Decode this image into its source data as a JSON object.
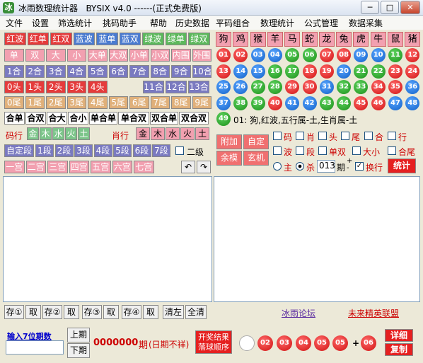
{
  "window": {
    "title": "冰雨数理统计器   BYSIX v4.0 ------(正式免费版)",
    "minimize": "─",
    "maximize": "□",
    "close": "✕"
  },
  "menu": [
    "文件",
    "设置",
    "筛选统计",
    "挑码助手",
    "帮助",
    "历史数据",
    "平码组合",
    "数理统计",
    "公式管理",
    "数据采集"
  ],
  "row1": [
    "红波",
    "红单",
    "红双",
    "蓝波",
    "蓝单",
    "蓝双",
    "绿波",
    "绿单",
    "绿双"
  ],
  "row2": [
    "单",
    "双",
    "大",
    "小",
    "大单",
    "大双",
    "小单",
    "小双",
    "内围",
    "外围"
  ],
  "row3": [
    "1合",
    "2合",
    "3合",
    "4合",
    "5合",
    "6合",
    "7合",
    "8合",
    "9合",
    "10合"
  ],
  "row4a": [
    "0头",
    "1头",
    "2头",
    "3头",
    "4头"
  ],
  "row4b": [
    "11合",
    "12合",
    "13合"
  ],
  "row5": [
    "0尾",
    "1尾",
    "2尾",
    "3尾",
    "4尾",
    "5尾",
    "6尾",
    "7尾",
    "8尾",
    "9尾"
  ],
  "row6": [
    "合单",
    "合双",
    "合大",
    "合小",
    "单合单",
    "单合双",
    "双合单",
    "双合双"
  ],
  "row7": {
    "label1": "码行",
    "elems1": [
      "金",
      "木",
      "水",
      "火",
      "土"
    ],
    "label2": "肖行",
    "elems2": [
      "金",
      "木",
      "水",
      "火",
      "土"
    ]
  },
  "row8": {
    "items": [
      "自定段",
      "1段",
      "2段",
      "3段",
      "4段",
      "5段",
      "6段",
      "7段"
    ],
    "check": "二级"
  },
  "row9": {
    "items": [
      "一宫",
      "二宫",
      "三宫",
      "四宫",
      "五宫",
      "六宫",
      "七宫"
    ],
    "undo": "↶",
    "redo": "↷"
  },
  "zodiacs": [
    "狗",
    "鸡",
    "猴",
    "羊",
    "马",
    "蛇",
    "龙",
    "兔",
    "虎",
    "牛",
    "鼠",
    "猪"
  ],
  "balls": [
    {
      "n": "01",
      "c": "r"
    },
    {
      "n": "02",
      "c": "r"
    },
    {
      "n": "03",
      "c": "b"
    },
    {
      "n": "04",
      "c": "b"
    },
    {
      "n": "05",
      "c": "g"
    },
    {
      "n": "06",
      "c": "g"
    },
    {
      "n": "07",
      "c": "r"
    },
    {
      "n": "08",
      "c": "r"
    },
    {
      "n": "09",
      "c": "b"
    },
    {
      "n": "10",
      "c": "b"
    },
    {
      "n": "11",
      "c": "g"
    },
    {
      "n": "12",
      "c": "r"
    },
    {
      "n": "13",
      "c": "r"
    },
    {
      "n": "14",
      "c": "b"
    },
    {
      "n": "15",
      "c": "b"
    },
    {
      "n": "16",
      "c": "g"
    },
    {
      "n": "17",
      "c": "g"
    },
    {
      "n": "18",
      "c": "r"
    },
    {
      "n": "19",
      "c": "r"
    },
    {
      "n": "20",
      "c": "b"
    },
    {
      "n": "21",
      "c": "g"
    },
    {
      "n": "22",
      "c": "g"
    },
    {
      "n": "23",
      "c": "r"
    },
    {
      "n": "24",
      "c": "r"
    },
    {
      "n": "25",
      "c": "b"
    },
    {
      "n": "26",
      "c": "b"
    },
    {
      "n": "27",
      "c": "g"
    },
    {
      "n": "28",
      "c": "g"
    },
    {
      "n": "29",
      "c": "r"
    },
    {
      "n": "30",
      "c": "r"
    },
    {
      "n": "31",
      "c": "b"
    },
    {
      "n": "32",
      "c": "g"
    },
    {
      "n": "33",
      "c": "g"
    },
    {
      "n": "34",
      "c": "r"
    },
    {
      "n": "35",
      "c": "r"
    },
    {
      "n": "36",
      "c": "b"
    },
    {
      "n": "37",
      "c": "b"
    },
    {
      "n": "38",
      "c": "g"
    },
    {
      "n": "39",
      "c": "g"
    },
    {
      "n": "40",
      "c": "r"
    },
    {
      "n": "41",
      "c": "b"
    },
    {
      "n": "42",
      "c": "b"
    },
    {
      "n": "43",
      "c": "g"
    },
    {
      "n": "44",
      "c": "g"
    },
    {
      "n": "45",
      "c": "r"
    },
    {
      "n": "46",
      "c": "r"
    },
    {
      "n": "47",
      "c": "b"
    },
    {
      "n": "48",
      "c": "b"
    }
  ],
  "info": {
    "ball": "49",
    "text": "01: 狗,红波,五行属-土,生肖属-土"
  },
  "side_buttons": [
    "附加",
    "自定",
    "余模",
    "玄机"
  ],
  "checks1": [
    "码",
    "肖",
    "头",
    "尾",
    "合",
    "行"
  ],
  "checks2": [
    "波",
    "段",
    "单双",
    "大小",
    "合尾"
  ],
  "radio": {
    "main": "主",
    "kill": "杀"
  },
  "period": {
    "value": "013",
    "label": "期",
    "plus": "+",
    "minus": "-",
    "change": "换行",
    "stat": "统计"
  },
  "bottom_buttons": [
    "存①",
    "取",
    "存②",
    "取",
    "存③",
    "取",
    "存④",
    "取",
    "清左",
    "全清"
  ],
  "links": {
    "forum": "冰雨论坛",
    "league": "未来精英联盟"
  },
  "footer": {
    "input_label": "输入7位期数",
    "prev": "上期",
    "next": "下期",
    "period_num": "0000000",
    "period_unit": "期",
    "period_note": "(日期不祥)",
    "result_btn": "开奖结果\n落球顺序",
    "plus": "+",
    "detail": "详细",
    "copy": "复制"
  },
  "result_balls": [
    {
      "n": "",
      "c": "w"
    },
    {
      "n": "02",
      "c": "r"
    },
    {
      "n": "03",
      "c": "r"
    },
    {
      "n": "04",
      "c": "r"
    },
    {
      "n": "05",
      "c": "r"
    },
    {
      "n": "05",
      "c": "r"
    },
    {
      "n": "06",
      "c": "r"
    }
  ]
}
